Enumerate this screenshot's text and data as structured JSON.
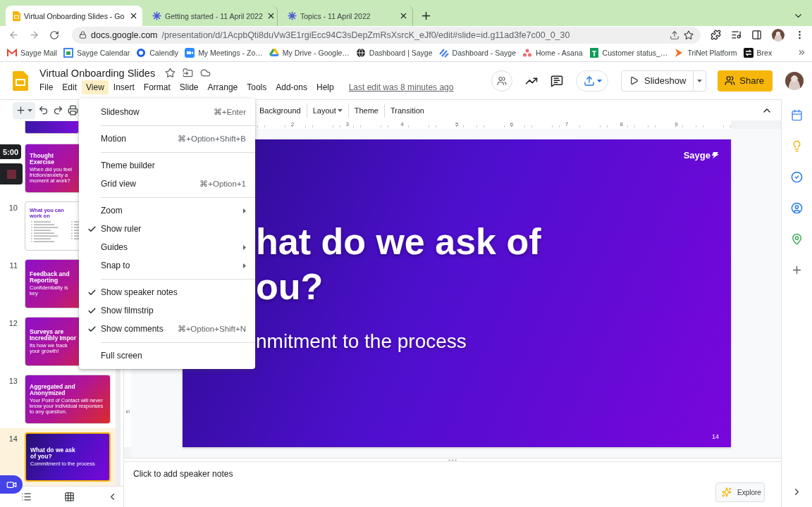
{
  "browser": {
    "tabs": [
      {
        "title": "Virtual Onboarding Slides - Go",
        "selected": true
      },
      {
        "title": "Getting started - 11 April 2022",
        "selected": false
      },
      {
        "title": "Topics - 11 April 2022",
        "selected": false
      }
    ],
    "address": {
      "host": "docs.google.com",
      "path": "/presentation/d/1AcpbQti8duVw3E1rgiEcc94C3sDepZmRsXsrcK_eJf0/edit#slide=id.g11ad3fe7c00_0_30"
    },
    "bookmarks": [
      "Sayge Mail",
      "Sayge Calendar",
      "Calendly",
      "My Meetings - Zo…",
      "My Drive - Google…",
      "Dashboard | Sayge",
      "Dashboard - Sayge",
      "Home - Asana",
      "Customer status_…",
      "TriNet Platform",
      "Brex"
    ]
  },
  "app": {
    "title": "Virtual Onboarding Slides",
    "menus": [
      {
        "label": "File",
        "selected": false
      },
      {
        "label": "Edit",
        "selected": false
      },
      {
        "label": "View",
        "selected": true
      },
      {
        "label": "Insert",
        "selected": false
      },
      {
        "label": "Format",
        "selected": false
      },
      {
        "label": "Slide",
        "selected": false
      },
      {
        "label": "Arrange",
        "selected": false
      },
      {
        "label": "Tools",
        "selected": false
      },
      {
        "label": "Add-ons",
        "selected": false
      },
      {
        "label": "Help",
        "selected": false
      }
    ],
    "last_edit": "Last edit was 8 minutes ago",
    "slideshow_button": "Slideshow",
    "share_button": "Share"
  },
  "toolbar": {
    "buttons": [
      {
        "label": "Background",
        "dropdown": false
      },
      {
        "label": "Layout",
        "dropdown": true
      },
      {
        "label": "Theme",
        "dropdown": false
      },
      {
        "label": "Transition",
        "dropdown": false
      }
    ]
  },
  "view_menu": {
    "items": [
      {
        "kind": "item",
        "label": "Slideshow",
        "shortcut": "⌘+Enter",
        "checked": false,
        "submenu": false
      },
      {
        "kind": "separator"
      },
      {
        "kind": "item",
        "label": "Motion",
        "shortcut": "⌘+Option+Shift+B",
        "checked": false,
        "submenu": false
      },
      {
        "kind": "separator"
      },
      {
        "kind": "item",
        "label": "Theme builder",
        "checked": false,
        "submenu": false
      },
      {
        "kind": "item",
        "label": "Grid view",
        "shortcut": "⌘+Option+1",
        "checked": false,
        "submenu": false
      },
      {
        "kind": "separator"
      },
      {
        "kind": "item",
        "label": "Zoom",
        "checked": false,
        "submenu": true
      },
      {
        "kind": "item",
        "label": "Show ruler",
        "checked": true,
        "submenu": false
      },
      {
        "kind": "item",
        "label": "Guides",
        "checked": false,
        "submenu": true
      },
      {
        "kind": "item",
        "label": "Snap to",
        "checked": false,
        "submenu": true
      },
      {
        "kind": "separator"
      },
      {
        "kind": "item",
        "label": "Show speaker notes",
        "checked": true,
        "submenu": false
      },
      {
        "kind": "item",
        "label": "Show filmstrip",
        "checked": true,
        "submenu": false
      },
      {
        "kind": "item",
        "label": "Show comments",
        "shortcut": "⌘+Option+Shift+N",
        "checked": true,
        "submenu": false
      },
      {
        "kind": "separator"
      },
      {
        "kind": "item",
        "label": "Full screen",
        "checked": false,
        "submenu": false
      }
    ]
  },
  "filmstrip": {
    "timer": "5:00",
    "slides": [
      {
        "kind": "partial",
        "selected": false
      },
      {
        "kind": "gradient",
        "title": "Thought Exercise",
        "subtitle": "When did you feel friction/anxiety a moment at work?",
        "selected": false
      },
      {
        "kind": "list",
        "number": "10",
        "title": "What you can work on",
        "selected": false
      },
      {
        "kind": "gradient",
        "number": "11",
        "title": "Feedback and Reporting",
        "subtitle": "Confidentiality is key",
        "selected": false
      },
      {
        "kind": "gradient",
        "number": "12",
        "title": "Surveys are Incredibly Impor",
        "subtitle": "Its how we track your growth!",
        "selected": false
      },
      {
        "kind": "gradient",
        "number": "13",
        "title": "Aggregated and Anonymized",
        "subtitle": "Your Point of Contact will never know your individual responses to any question.",
        "selected": false
      },
      {
        "kind": "dark",
        "number": "14",
        "title": "What do we ask of you?",
        "subtitle": "Commitment to the process",
        "selected": true
      }
    ]
  },
  "ruler": {
    "horizontal": [
      "2",
      "3",
      "4",
      "5",
      "6",
      "7",
      "8",
      "9"
    ],
    "vertical": [
      "5"
    ]
  },
  "slide": {
    "logo": "Sayge",
    "title_lines": [
      "hat do we ask of",
      "ou?"
    ],
    "subtitle": "nmitment to the process",
    "number": "14"
  },
  "notes": {
    "placeholder": "Click to add speaker notes"
  },
  "explore_button": "Explore"
}
